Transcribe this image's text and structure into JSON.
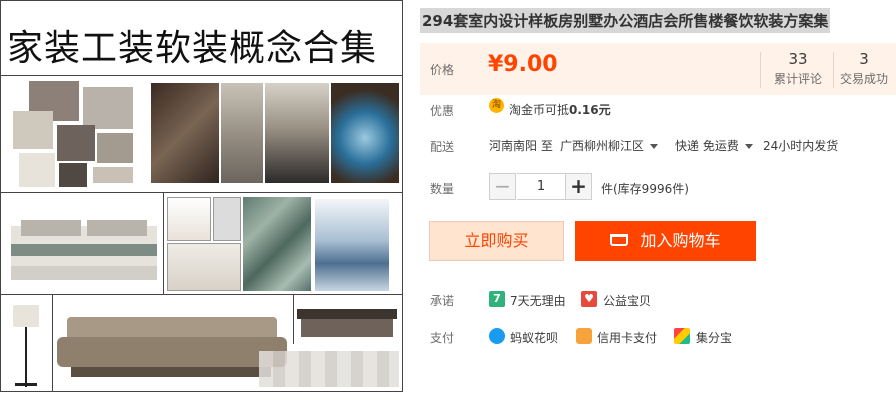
{
  "gallery": {
    "title": "家装工装软装概念合集"
  },
  "product": {
    "title": "294套室内设计样板房别墅办公酒店会所售楼餐饮软装方案集"
  },
  "price": {
    "label": "价格",
    "value": "¥9.00"
  },
  "stats": [
    {
      "num": "33",
      "caption": "累计评论"
    },
    {
      "num": "3",
      "caption": "交易成功"
    }
  ],
  "promo": {
    "label": "优惠",
    "coin_icon_char": "淘",
    "text": "淘金币可抵",
    "amount": "0.16元"
  },
  "delivery": {
    "label": "配送",
    "from": "河南南阳 至",
    "to": "广西柳州柳江区",
    "method": "快递 免运费",
    "ship_time": "24小时内发货"
  },
  "quantity": {
    "label": "数量",
    "minus": "−",
    "value": "1",
    "plus": "+",
    "stock": "件(库存9996件)"
  },
  "buttons": {
    "buy_now": "立即购买",
    "add_to_cart": "加入购物车"
  },
  "promise": {
    "label": "承诺",
    "items": [
      {
        "icon": "7",
        "text": "7天无理由"
      },
      {
        "icon": "♥",
        "text": "公益宝贝"
      }
    ]
  },
  "payment": {
    "label": "支付",
    "items": [
      {
        "text": "蚂蚁花呗"
      },
      {
        "text": "信用卡支付"
      },
      {
        "text": "集分宝"
      }
    ]
  },
  "colors": {
    "accent": "#ff4400",
    "price_bg": "#fff2e8",
    "buy_bg": "#ffe4d0"
  }
}
